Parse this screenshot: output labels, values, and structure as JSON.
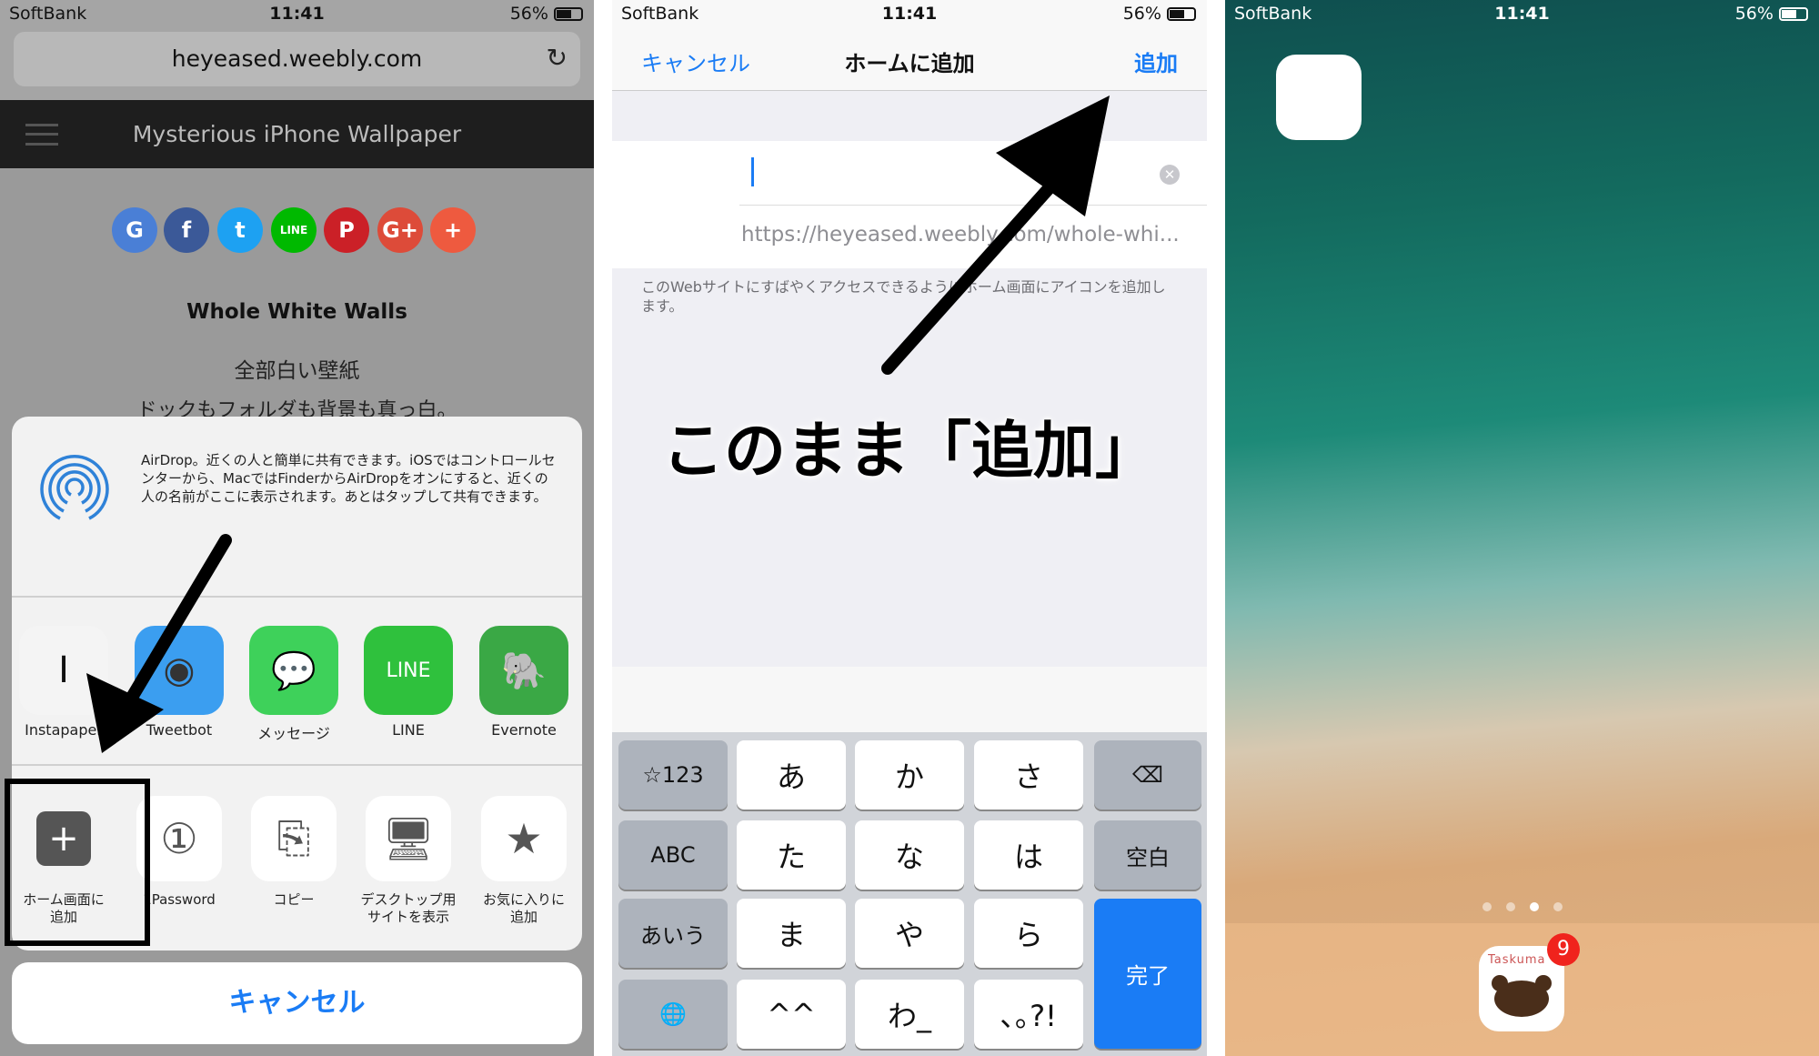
{
  "status": {
    "carrier": "SoftBank",
    "time": "11:41",
    "battery": "56%",
    "battery_level": 0.56
  },
  "panel1": {
    "url": "heyeased.weebly.com",
    "site_title": "Mysterious iPhone Wallpaper",
    "social_icons": [
      {
        "name": "google-translate",
        "glyph": "G",
        "color": "#4a7fd6"
      },
      {
        "name": "facebook",
        "glyph": "f",
        "color": "#3b5998"
      },
      {
        "name": "twitter",
        "glyph": "t",
        "color": "#1da1f2"
      },
      {
        "name": "line",
        "glyph": "LINE",
        "color": "#00b900"
      },
      {
        "name": "pinterest",
        "glyph": "P",
        "color": "#cb2027"
      },
      {
        "name": "google-plus",
        "glyph": "G+",
        "color": "#dd4b39"
      },
      {
        "name": "more",
        "glyph": "+",
        "color": "#ee5a3f"
      }
    ],
    "heading": "Whole White Walls",
    "subheading": "全部白い壁紙",
    "body": "ドックもフォルダも背景も真っ白。",
    "airdrop_text": "AirDrop。近くの人と簡単に共有できます。iOSではコントロールセンターから、MacではFinderからAirDropをオンにすると、近くの人の名前がここに表示されます。あとはタップして共有できます。",
    "apps": [
      {
        "label": "Instapaper",
        "glyph": "I",
        "bg": "#f4f4f4",
        "fg": "#111"
      },
      {
        "label": "Tweetbot",
        "glyph": "◉",
        "bg": "#3b9ef0",
        "fg": "#333"
      },
      {
        "label": "メッセージ",
        "glyph": "💬",
        "bg": "#3ed15a",
        "fg": "#fff"
      },
      {
        "label": "LINE",
        "glyph": "LINE",
        "bg": "#2fc13d",
        "fg": "#fff"
      },
      {
        "label": "Evernote",
        "glyph": "🐘",
        "bg": "#3aa845",
        "fg": "#222"
      }
    ],
    "actions": [
      {
        "label": "ホーム画面に\n追加",
        "glyph": "+"
      },
      {
        "label": "1Password",
        "glyph": "①"
      },
      {
        "label": "コピー",
        "glyph": "⎘"
      },
      {
        "label": "デスクトップ用\nサイトを表示",
        "glyph": "🖥"
      },
      {
        "label": "お気に入りに\n追加",
        "glyph": "★"
      }
    ],
    "cancel": "キャンセル",
    "accent": "#1a7cf5"
  },
  "panel2": {
    "cancel": "キャンセル",
    "title": "ホームに追加",
    "add": "追加",
    "name_value": "",
    "url": "https://heyeased.weebly.com/whole-whi...",
    "footer": "このWebサイトにすばやくアクセスできるようにホーム画面にアイコンを追加します。",
    "annotation": "このまま「追加」",
    "keys": [
      [
        "☆123",
        "あ",
        "か",
        "さ",
        "⌫"
      ],
      [
        "ABC",
        "た",
        "な",
        "は",
        "空白"
      ],
      [
        "あいう",
        "ま",
        "や",
        "ら",
        "完了"
      ],
      [
        "🌐",
        "^^",
        "わ_",
        "､｡?!"
      ]
    ]
  },
  "panel3": {
    "page_count": 4,
    "current_page": 3,
    "dock_app": {
      "label": "Taskuma",
      "badge": "9"
    }
  }
}
